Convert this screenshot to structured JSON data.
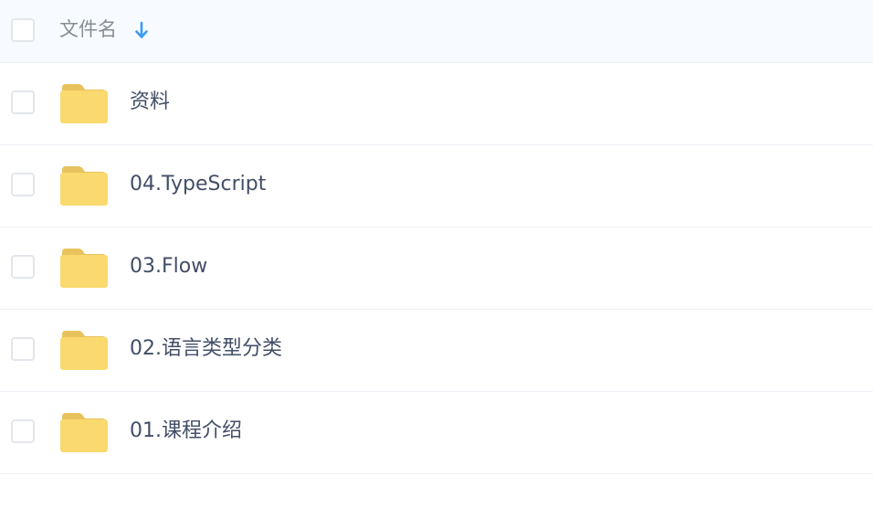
{
  "header": {
    "column_label": "文件名",
    "sort_icon": "arrow-down-icon",
    "sort_color": "#3b9cf5"
  },
  "files": [
    {
      "name": "资料",
      "icon": "folder-icon"
    },
    {
      "name": "04.TypeScript",
      "icon": "folder-icon"
    },
    {
      "name": "03.Flow",
      "icon": "folder-icon"
    },
    {
      "name": "02.语言类型分类",
      "icon": "folder-icon"
    },
    {
      "name": "01.课程介绍",
      "icon": "folder-icon"
    }
  ],
  "colors": {
    "folder_body": "#fad96e",
    "folder_tab": "#e8c25c",
    "header_bg": "#f7fbff",
    "text": "#424e67"
  }
}
